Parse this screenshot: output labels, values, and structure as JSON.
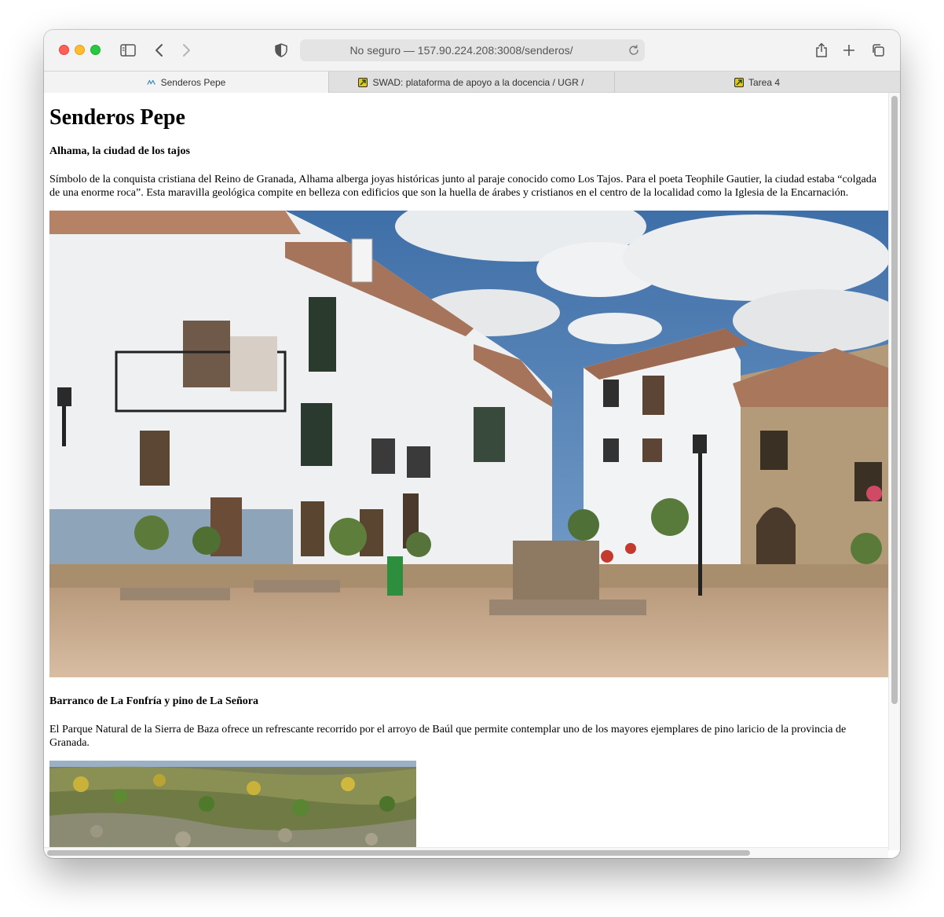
{
  "browser": {
    "address": "No seguro — 157.90.224.208:3008/senderos/",
    "tabs": [
      {
        "label": "Senderos Pepe",
        "active": true,
        "icon": "senderos-favicon"
      },
      {
        "label": "SWAD: plataforma de apoyo a la docencia / UGR /",
        "active": false,
        "icon": "swad-favicon"
      },
      {
        "label": "Tarea 4",
        "active": false,
        "icon": "swad-favicon"
      }
    ],
    "toolbar_icons": [
      "sidebar-icon",
      "back-icon",
      "forward-icon",
      "privacy-shield-icon",
      "reload-icon",
      "share-icon",
      "new-tab-icon",
      "tab-overview-icon"
    ]
  },
  "page": {
    "title": "Senderos Pepe",
    "sections": [
      {
        "heading": "Alhama, la ciudad de los tajos",
        "text": "Símbolo de la conquista cristiana del Reino de Granada, Alhama alberga joyas históricas junto al paraje conocido como Los Tajos. Para el poeta Teophile Gautier, la ciudad estaba “colgada de una enorme roca”. Esta maravilla geológica compite en belleza con edificios que son la huella de árabes y cristianos en el centro de la localidad como la Iglesia de la Encarnación."
      },
      {
        "heading": "Barranco de La Fonfría y pino de La Señora",
        "text": "El Parque Natural de la Sierra de Baza ofrece un refrescante recorrido por el arroyo de Baúl que permite contemplar uno de los mayores ejemplares de pino laricio de la provincia de Granada."
      }
    ]
  },
  "colors": {
    "close": "#fe5f57",
    "minimize": "#febc2e",
    "zoom": "#28c840",
    "swad_favicon": "#2f6b1f"
  }
}
